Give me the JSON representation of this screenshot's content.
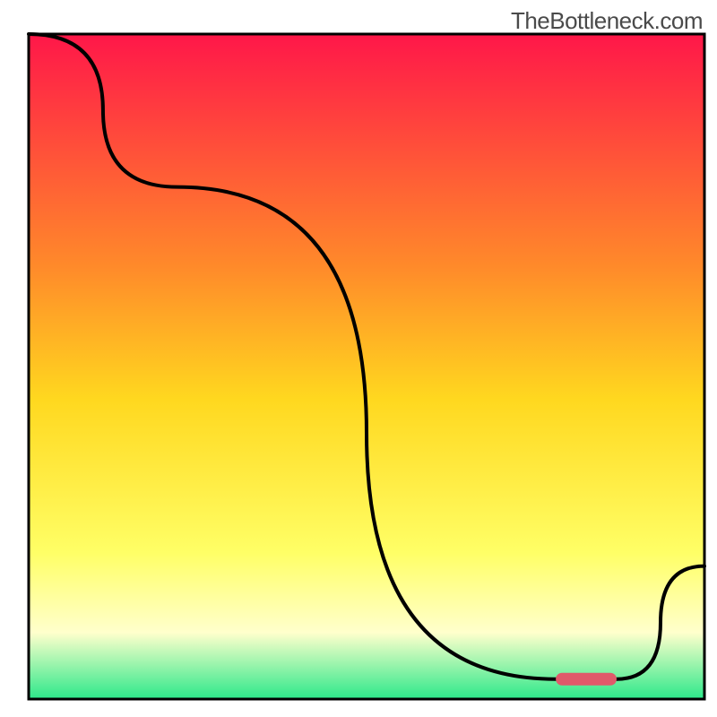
{
  "attribution": "TheBottleneck.com",
  "colors": {
    "grad_top": "#ff1749",
    "grad_mid1": "#ff8a2a",
    "grad_mid2": "#ffd81f",
    "grad_mid3": "#ffff66",
    "grad_mid4": "#ffffcc",
    "grad_bottom": "#2ce88a",
    "border": "#000000",
    "line": "#000000",
    "segment": "#e05a6a"
  },
  "chart_data": {
    "type": "line",
    "title": "",
    "xlabel": "",
    "ylabel": "",
    "xlim": [
      0,
      100
    ],
    "ylim": [
      0,
      100
    ],
    "series": [
      {
        "name": "curve",
        "x": [
          0,
          22,
          78,
          87,
          100
        ],
        "values": [
          100,
          77,
          3,
          3,
          20
        ]
      }
    ],
    "marker_segment": {
      "x0": 78,
      "x1": 87,
      "y": 3
    }
  }
}
